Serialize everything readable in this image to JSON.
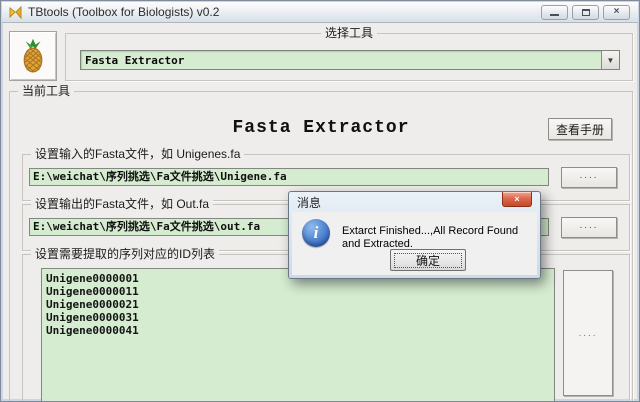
{
  "window": {
    "title": "TBtools (Toolbox for Biologists) v0.2"
  },
  "icons": {
    "close": "×",
    "dropdown": "▼",
    "info": "i"
  },
  "tool_selector": {
    "legend": "选择工具",
    "selected": "Fasta Extractor"
  },
  "current_tool": {
    "legend": "当前工具",
    "heading": "Fasta Extractor",
    "manual_button": "查看手册",
    "input": {
      "legend": "设置输入的Fasta文件，如 Unigenes.fa",
      "value": "E:\\weichat\\序列挑选\\Fa文件挑选\\Unigene.fa",
      "browse": "...."
    },
    "output": {
      "legend": "设置输出的Fasta文件，如 Out.fa",
      "value": "E:\\weichat\\序列挑选\\Fa文件挑选\\out.fa",
      "browse": "...."
    },
    "id_list": {
      "legend": "设置需要提取的序列对应的ID列表",
      "values": [
        "Unigene0000001",
        "Unigene0000011",
        "Unigene0000021",
        "Unigene0000031",
        "Unigene0000041"
      ],
      "browse": "...."
    }
  },
  "dialog": {
    "title": "消息",
    "message": "Extarct Finished...,All Record Found and Extracted.",
    "ok_label": "确定"
  },
  "colors": {
    "field_green": "#d5ecd1",
    "window_bg": "#efedeb",
    "dialog_close_red": "#c24a2d",
    "info_blue": "#3a6ec6"
  }
}
